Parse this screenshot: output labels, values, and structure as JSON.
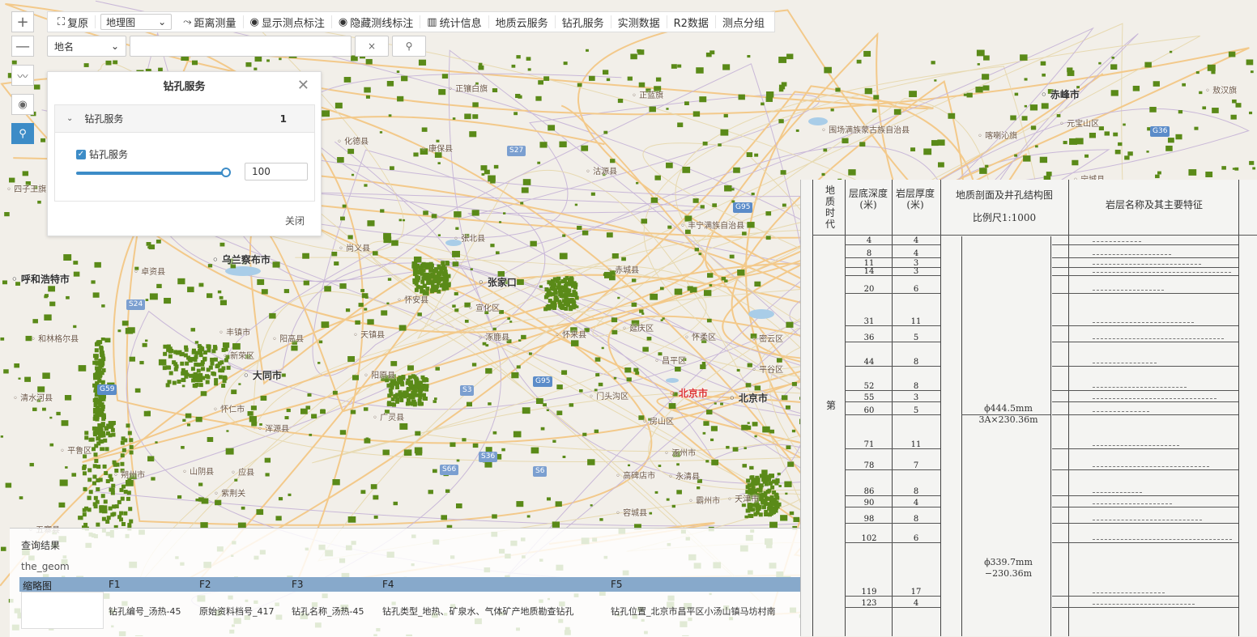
{
  "toolbar": {
    "zoom_in": "+",
    "zoom_out": "—",
    "reset": "复原",
    "map_type": "地理图",
    "distance": "距离测量",
    "show_points": "显示测点标注",
    "hide_lines": "隐藏测线标注",
    "stats": "统计信息",
    "geo_cloud": "地质云服务",
    "drill": "钻孔服务",
    "measured": "实测数据",
    "r2": "R2数据",
    "group": "测点分组"
  },
  "search": {
    "type": "地名",
    "value": "",
    "clear": "×"
  },
  "panel": {
    "title": "钻孔服务",
    "section": "钻孔服务",
    "count": "1",
    "layer_label": "钻孔服务",
    "opacity": "100",
    "opacity_fraction": 1.0,
    "close": "关闭"
  },
  "map": {
    "places": [
      {
        "t": "正镶白旗",
        "c": ""
      },
      {
        "t": "正蓝旗",
        "c": ""
      },
      {
        "t": "赤峰市",
        "c": "big"
      },
      {
        "t": "敖汉旗",
        "c": ""
      },
      {
        "t": "围场满族蒙古族自治县",
        "c": ""
      },
      {
        "t": "喀喇沁旗",
        "c": ""
      },
      {
        "t": "元宝山区",
        "c": ""
      },
      {
        "t": "宁城县",
        "c": ""
      },
      {
        "t": "化德县",
        "c": ""
      },
      {
        "t": "康保县",
        "c": ""
      },
      {
        "t": "沽源县",
        "c": ""
      },
      {
        "t": "四子王旗",
        "c": ""
      },
      {
        "t": "丰宁满族自治县",
        "c": ""
      },
      {
        "t": "尚义县",
        "c": ""
      },
      {
        "t": "乌兰察布市",
        "c": "big"
      },
      {
        "t": "呼和浩特市",
        "c": "big"
      },
      {
        "t": "卓资县",
        "c": ""
      },
      {
        "t": "张北县",
        "c": ""
      },
      {
        "t": "张家口",
        "c": "big"
      },
      {
        "t": "赤城县",
        "c": ""
      },
      {
        "t": "怀安县",
        "c": ""
      },
      {
        "t": "宣化区",
        "c": ""
      },
      {
        "t": "丰镇市",
        "c": ""
      },
      {
        "t": "和林格尔县",
        "c": ""
      },
      {
        "t": "阳高县",
        "c": ""
      },
      {
        "t": "天镇县",
        "c": ""
      },
      {
        "t": "涿鹿县",
        "c": ""
      },
      {
        "t": "怀来县",
        "c": ""
      },
      {
        "t": "延庆区",
        "c": ""
      },
      {
        "t": "怀柔区",
        "c": ""
      },
      {
        "t": "密云区",
        "c": ""
      },
      {
        "t": "新荣区",
        "c": ""
      },
      {
        "t": "大同市",
        "c": "big"
      },
      {
        "t": "阳原县",
        "c": ""
      },
      {
        "t": "昌平区",
        "c": ""
      },
      {
        "t": "平谷区",
        "c": ""
      },
      {
        "t": "清水河县",
        "c": ""
      },
      {
        "t": "怀仁市",
        "c": ""
      },
      {
        "t": "门头沟区",
        "c": ""
      },
      {
        "t": "北京市",
        "c": "capital"
      },
      {
        "t": "北京市",
        "c": "big"
      },
      {
        "t": "广灵县",
        "c": ""
      },
      {
        "t": "浑源县",
        "c": ""
      },
      {
        "t": "房山区",
        "c": ""
      },
      {
        "t": "平鲁区",
        "c": ""
      },
      {
        "t": "朔州市",
        "c": ""
      },
      {
        "t": "山阴县",
        "c": ""
      },
      {
        "t": "应县",
        "c": ""
      },
      {
        "t": "涿州市",
        "c": ""
      },
      {
        "t": "高碑店市",
        "c": ""
      },
      {
        "t": "永清县",
        "c": ""
      },
      {
        "t": "紫荆关",
        "c": ""
      },
      {
        "t": "五寨县",
        "c": ""
      },
      {
        "t": "容城县",
        "c": ""
      },
      {
        "t": "霸州市",
        "c": ""
      },
      {
        "t": "天津市",
        "c": ""
      }
    ],
    "shields": [
      "S27",
      "G95",
      "S24",
      "G59",
      "G95",
      "S3",
      "S66",
      "S6",
      "G36",
      "S36"
    ]
  },
  "geology": {
    "headers": [
      "地质时代",
      "层底深度(米)",
      "岩层厚度(米)",
      "地质剖面及井孔结构图",
      "比例尺1:1000",
      "岩层名称及其主要特征"
    ],
    "era_mark": "第",
    "depths": [
      "4",
      "8",
      "11",
      "14",
      "20",
      "31",
      "36",
      "44",
      "52",
      "55",
      "60",
      "71",
      "78",
      "86",
      "90",
      "98",
      "102",
      "119",
      "123"
    ],
    "thickness": [
      "4",
      "4",
      "3",
      "3",
      "6",
      "11",
      "5",
      "8",
      "8",
      "3",
      "5",
      "11",
      "7",
      "8",
      "4",
      "8",
      "6",
      "17",
      "4"
    ],
    "well1": "ϕ444.5mm",
    "well1b": "3A×230.36m",
    "well2": "ϕ339.7mm",
    "well2b": "−230.36m"
  },
  "results": {
    "title": "查询结果",
    "geom": "the_geom",
    "headers": [
      "缩略图",
      "F1",
      "F2",
      "F3",
      "F4",
      "F5"
    ],
    "row": [
      "钻孔编号_汤热-45",
      "原始资料档号_417",
      "钻孔名称_汤热-45",
      "钻孔类型_地热、矿泉水、气体矿产地质勘查钻孔",
      "钻孔位置_北京市昌平区小汤山镇马坊村南"
    ]
  },
  "colors": {
    "accent": "#3d8cc7",
    "drill": "#5a8a18",
    "header": "#87a9cb"
  }
}
